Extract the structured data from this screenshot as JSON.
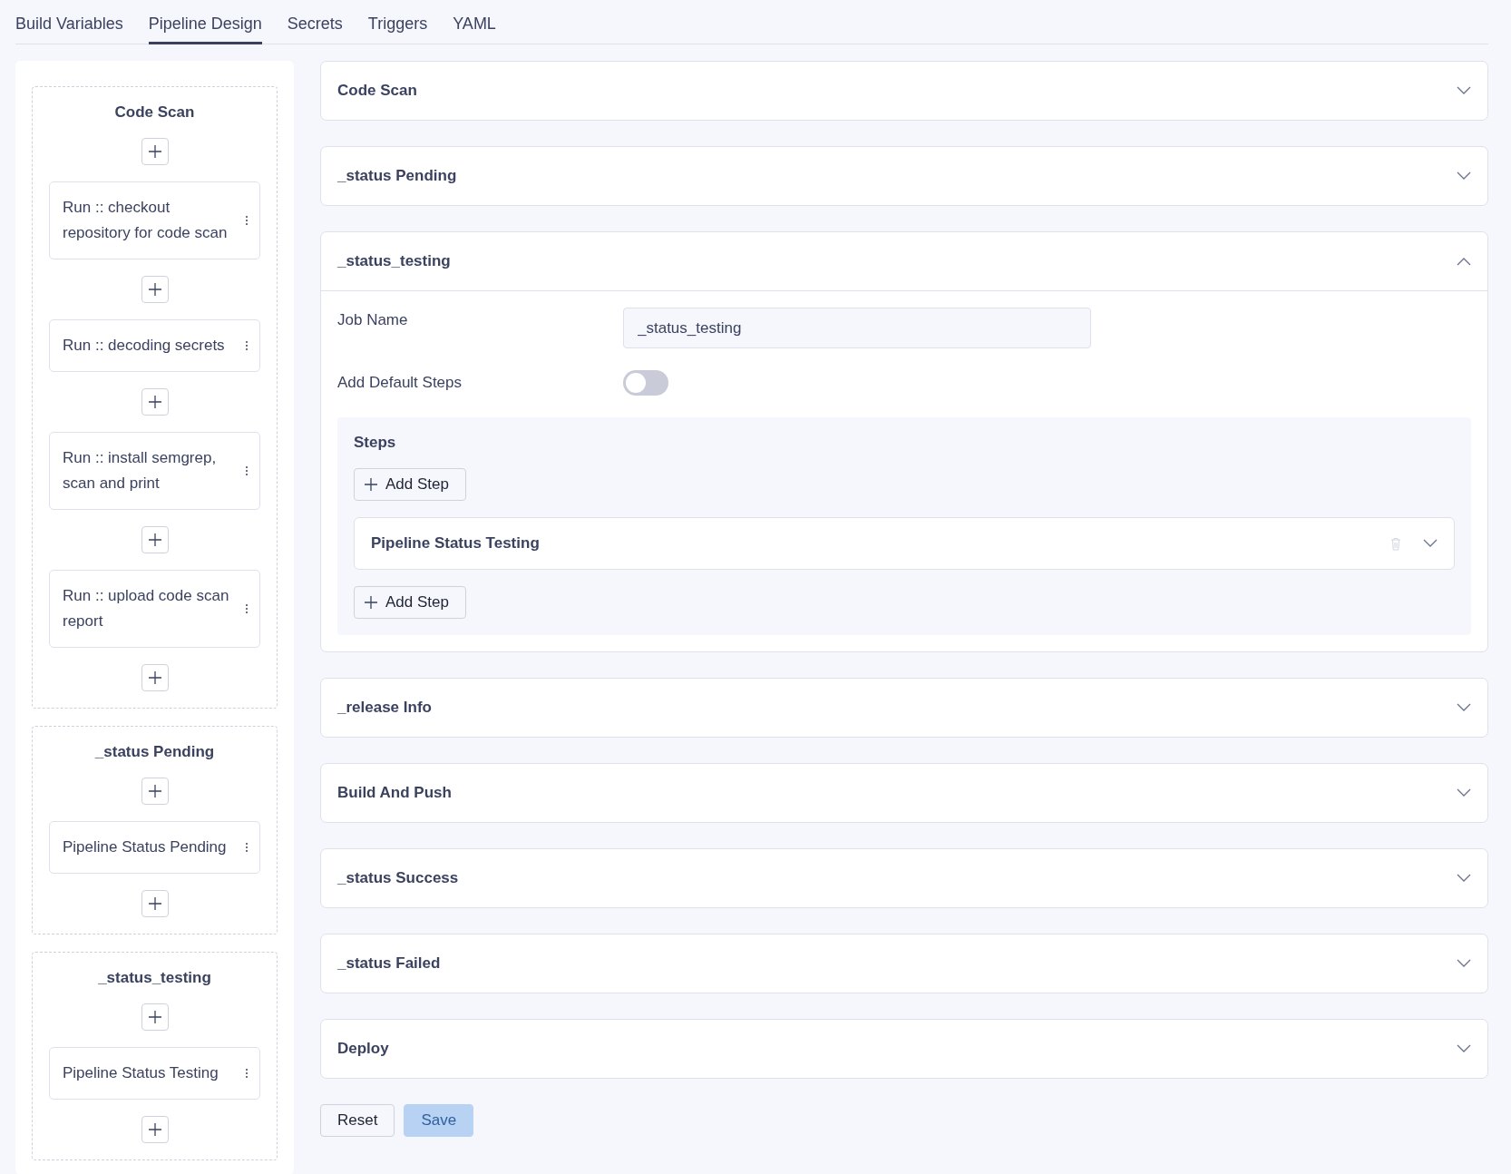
{
  "tabs": [
    {
      "label": "Build Variables",
      "selected": false
    },
    {
      "label": "Pipeline Design",
      "selected": true
    },
    {
      "label": "Secrets",
      "selected": false
    },
    {
      "label": "Triggers",
      "selected": false
    },
    {
      "label": "YAML",
      "selected": false
    }
  ],
  "stages": [
    {
      "title": "Code Scan",
      "steps": [
        "Run :: checkout repository for code scan",
        "Run :: decoding secrets",
        "Run :: install semgrep, scan and print",
        "Run :: upload code scan report"
      ]
    },
    {
      "title": "_status Pending",
      "steps": [
        "Pipeline Status Pending"
      ]
    },
    {
      "title": "_status_testing",
      "steps": [
        "Pipeline Status Testing"
      ]
    }
  ],
  "jobs": [
    {
      "title": "Code Scan",
      "expanded": false
    },
    {
      "title": "_status Pending",
      "expanded": false
    },
    {
      "title": "_status_testing",
      "expanded": true,
      "job_name": {
        "label": "Job Name",
        "value": "_status_testing"
      },
      "default_steps": {
        "label": "Add Default Steps",
        "on": false
      },
      "steps": {
        "title": "Steps",
        "add_top": "Add Step",
        "items": [
          {
            "name": "Pipeline Status Testing",
            "expanded": false
          }
        ],
        "add_bottom": "Add Step"
      }
    },
    {
      "title": "_release Info",
      "expanded": false
    },
    {
      "title": "Build And Push",
      "expanded": false
    },
    {
      "title": "_status Success",
      "expanded": false
    },
    {
      "title": "_status Failed",
      "expanded": false
    },
    {
      "title": "Deploy",
      "expanded": false
    }
  ],
  "actions": [
    {
      "label": "Reset",
      "disabled": false
    },
    {
      "label": "Save",
      "disabled": true
    }
  ]
}
